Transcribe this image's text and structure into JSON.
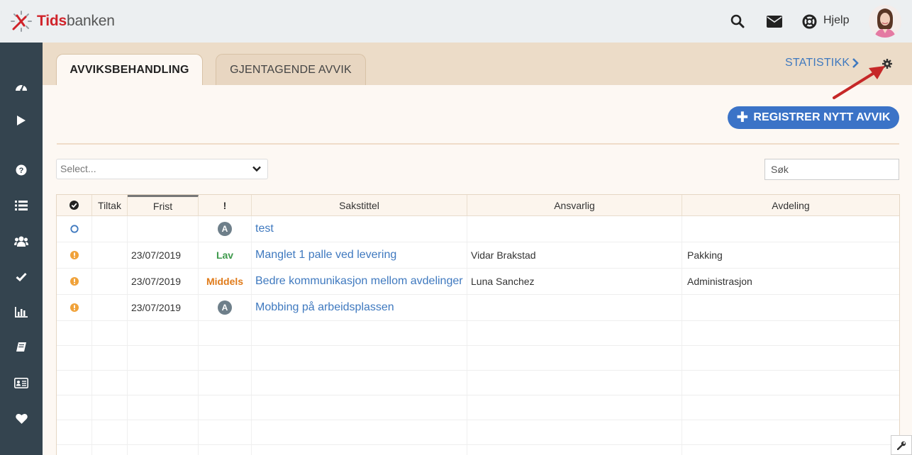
{
  "header": {
    "logo": {
      "brand_red": "Tids",
      "brand_grey": "banken"
    },
    "help_label": "Hjelp",
    "icons": [
      "search-icon",
      "envelope-icon",
      "lifebuoy-icon"
    ]
  },
  "sidebar": {
    "items": [
      "dashboard-icon",
      "play-icon",
      "question-icon",
      "list-icon",
      "users-icon",
      "check-icon",
      "bar-chart-icon",
      "book-icon",
      "id-card-icon",
      "heart-icon"
    ]
  },
  "tabs": [
    {
      "label": "AVVIKSBEHANDLING",
      "active": true
    },
    {
      "label": "GJENTAGENDE AVVIK",
      "active": false
    }
  ],
  "statistikk_label": "STATISTIKK",
  "register_button": {
    "label": "REGISTRER NYTT AVVIK"
  },
  "filters": {
    "select_placeholder": "Select...",
    "search_placeholder": "Søk"
  },
  "table": {
    "columns": [
      "",
      "Tiltak",
      "Frist",
      "!",
      "Sakstittel",
      "Ansvarlig",
      "Avdeling"
    ],
    "rows": [
      {
        "status": "open",
        "tiltak": "",
        "frist": "",
        "priority": "A",
        "sakstittel": "test",
        "ansvarlig": "",
        "avdeling": ""
      },
      {
        "status": "warning",
        "tiltak": "",
        "frist": "23/07/2019",
        "priority": "Lav",
        "sakstittel": "Manglet 1 palle ved levering",
        "ansvarlig": "Vidar Brakstad",
        "avdeling": "Pakking"
      },
      {
        "status": "warning",
        "tiltak": "",
        "frist": "23/07/2019",
        "priority": "Middels",
        "sakstittel": "Bedre kommunikasjon mellom avdelinger",
        "ansvarlig": "Luna Sanchez",
        "avdeling": "Administrasjon"
      },
      {
        "status": "warning",
        "tiltak": "",
        "frist": "23/07/2019",
        "priority": "A",
        "sakstittel": "Mobbing på arbeidsplassen",
        "ansvarlig": "",
        "avdeling": ""
      }
    ]
  },
  "colors": {
    "sidebar": "#34444f",
    "tab_band": "#ecdcc8",
    "primary": "#3b73c7",
    "link": "#3f79bf",
    "warning": "#f0a23a",
    "prio_lav": "#3e9a4c",
    "prio_middels": "#e07b1a"
  }
}
